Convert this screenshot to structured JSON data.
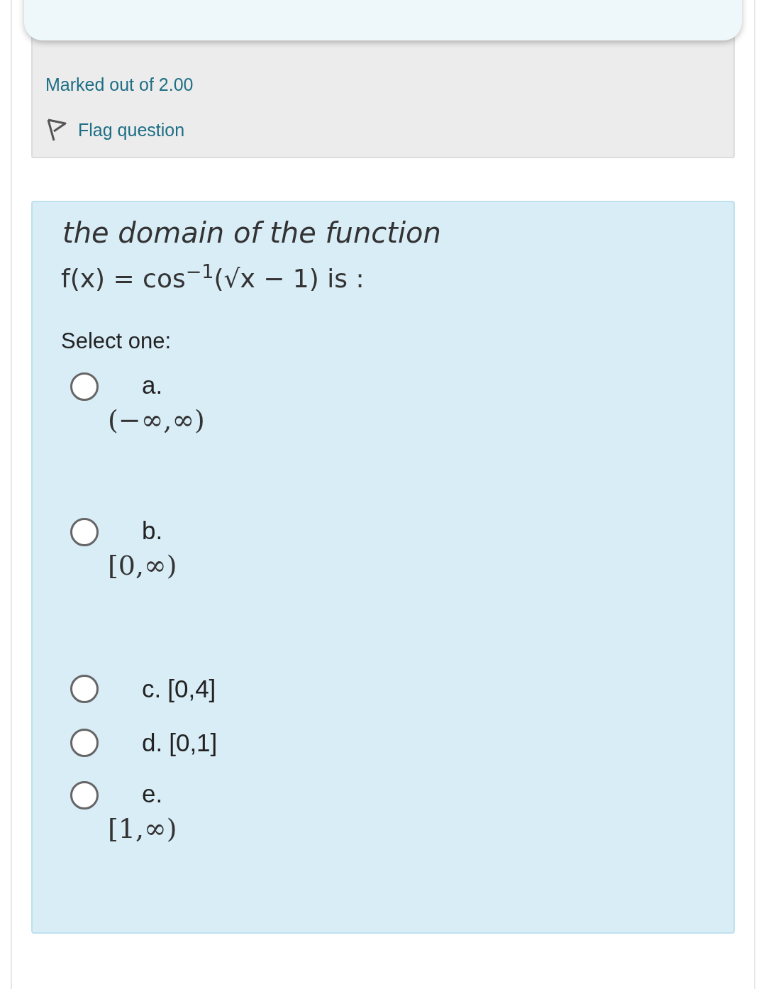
{
  "info": {
    "marks": "Marked out of 2.00",
    "flag": {
      "label": "Flag question",
      "flagged": false
    }
  },
  "question": {
    "text": "the domain of the function",
    "formula": "f(x) = cos$^{−1}$(√x − 1) is :",
    "prompt": "Select one:",
    "options": [
      {
        "kind": "stacked",
        "letter": "a.",
        "answer": "(−∞,∞)",
        "selected": false
      },
      {
        "kind": "stacked",
        "letter": "b.",
        "answer": "[0,∞)",
        "selected": false
      },
      {
        "kind": "inline",
        "letter": "c.",
        "answer": "[0,4]",
        "selected": false
      },
      {
        "kind": "inline",
        "letter": "d.",
        "answer": "[0,1]",
        "selected": false
      },
      {
        "kind": "stacked",
        "letter": "e.",
        "answer": "[1,∞)",
        "selected": false
      }
    ]
  }
}
